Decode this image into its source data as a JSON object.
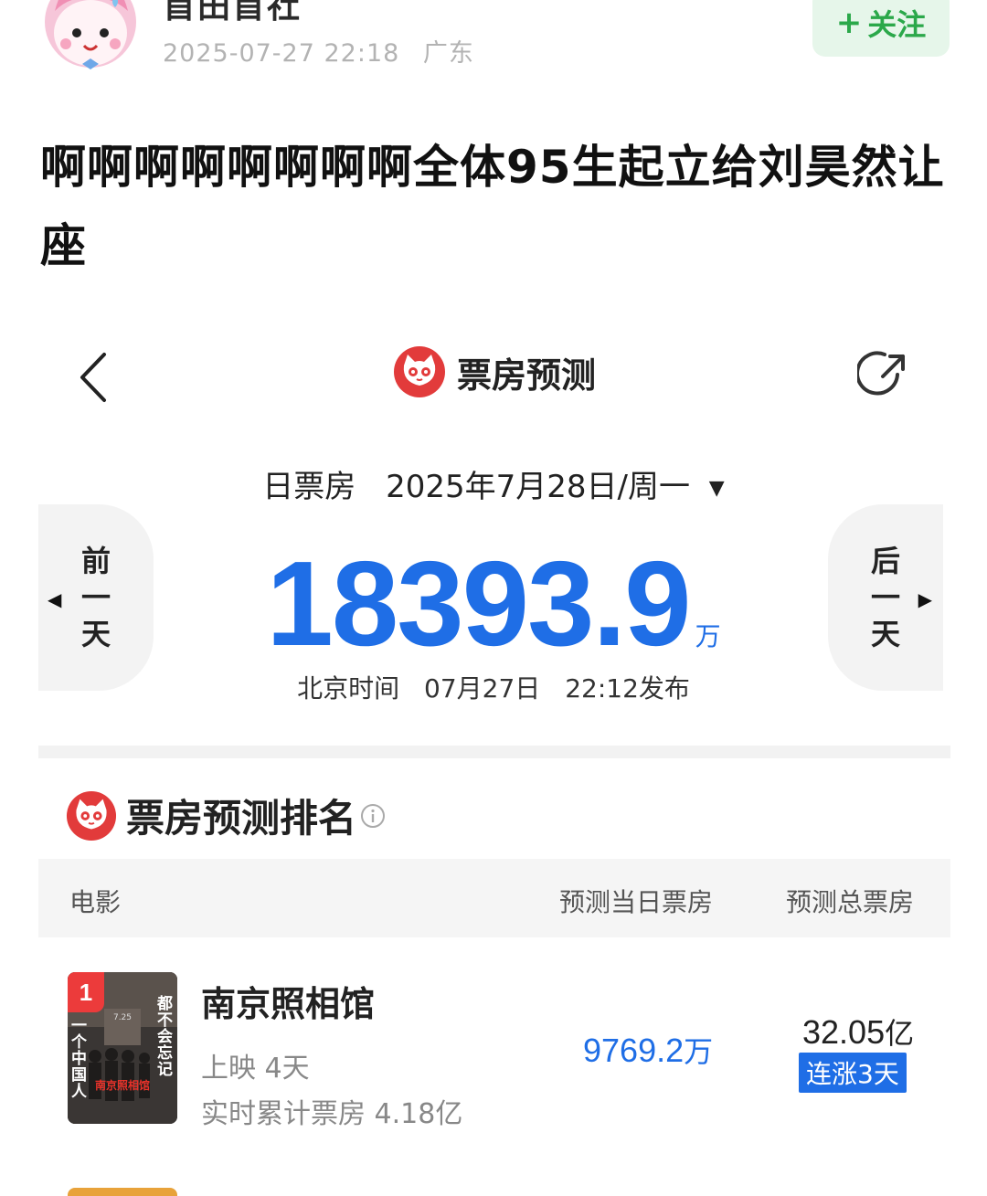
{
  "post": {
    "author_name": "首田首社",
    "timestamp": "2025-07-27 22:18",
    "location": "广东",
    "follow_label": "关注",
    "follow_prefix": "+",
    "title": "啊啊啊啊啊啊啊啊全体95生起立给刘昊然让座"
  },
  "boxoffice": {
    "nav_title": "票房预测",
    "date_label": "日票房",
    "date_value": "2025年7月28日/周一",
    "prev_label": "前一天",
    "next_label": "后一天",
    "total": "18393.9",
    "total_unit": "万",
    "publish_prefix": "北京时间",
    "publish_date": "07月27日",
    "publish_time": "22:12发布",
    "ranking_title": "票房预测排名",
    "columns": {
      "movie": "电影",
      "day": "预测当日票房",
      "total": "预测总票房"
    },
    "movies": [
      {
        "rank": "1",
        "name": "南京照相馆",
        "days_showing": "上映 4天",
        "cumulative": "实时累计票房 4.18亿",
        "predicted_day": "9769.2",
        "predicted_day_unit": "万",
        "predicted_total": "32.05",
        "predicted_total_unit": "亿",
        "trend_badge": "连涨3天",
        "poster_text": {
          "right": "都不会忘记",
          "left": "一个中国人",
          "title": "南京照相馆",
          "date": "7.25"
        }
      }
    ]
  },
  "colors": {
    "accent_blue": "#1f6ee6",
    "follow_green": "#2ba84a",
    "rank_red": "#ec3b3b",
    "cat_red": "#e23b3b"
  }
}
